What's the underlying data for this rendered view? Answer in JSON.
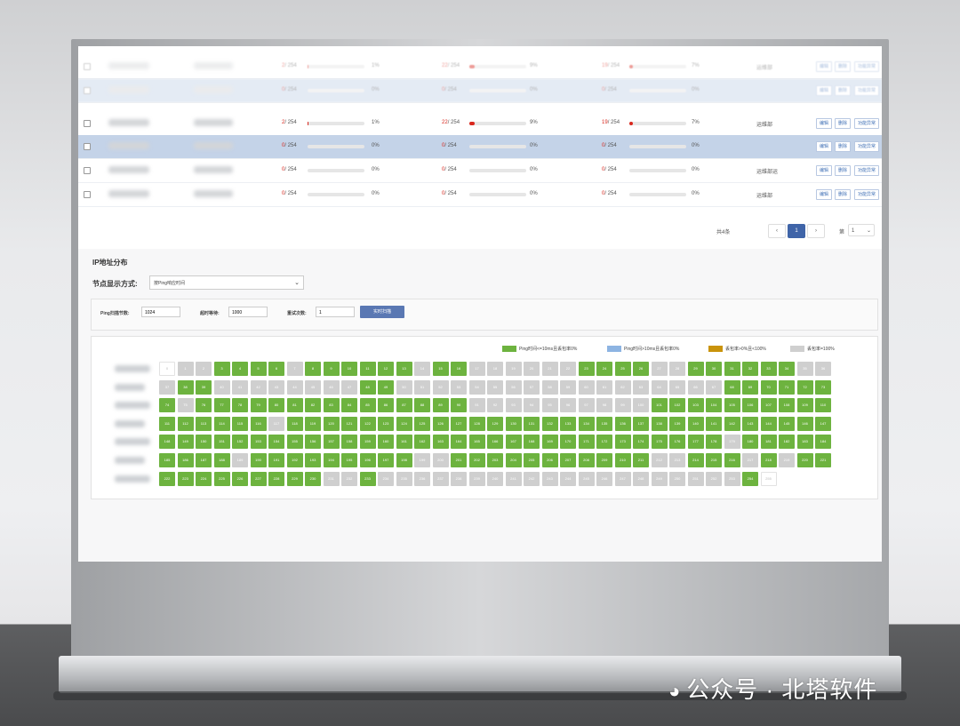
{
  "table": {
    "rows": [
      {
        "c1": "2/ 254",
        "p1": "1%",
        "f1": 0.01,
        "c2": "22/ 254",
        "p2": "9%",
        "f2": 0.09,
        "c3": "19/ 254",
        "p3": "7%",
        "f3": 0.07,
        "status": "运维部",
        "actions": [
          "编辑",
          "删除",
          "功能异常"
        ],
        "faded": true
      },
      {
        "c1": "0/ 254",
        "p1": "0%",
        "f1": 0,
        "c2": "0/ 254",
        "p2": "0%",
        "f2": 0,
        "c3": "0/ 254",
        "p3": "0%",
        "f3": 0,
        "status": "",
        "actions": [
          "编辑",
          "删除",
          "功能异常"
        ],
        "faded": true
      },
      {
        "c1": "2/ 254",
        "p1": "1%",
        "f1": 0.01,
        "c2": "22/ 254",
        "p2": "9%",
        "f2": 0.09,
        "c3": "19/ 254",
        "p3": "7%",
        "f3": 0.07,
        "status": "运维部",
        "actions": [
          "编辑",
          "删除",
          "功能异常"
        ],
        "faded": false
      },
      {
        "c1": "0/ 254",
        "p1": "0%",
        "f1": 0,
        "c2": "0/ 254",
        "p2": "0%",
        "f2": 0,
        "c3": "0/ 254",
        "p3": "0%",
        "f3": 0,
        "status": "",
        "actions": [
          "编辑",
          "删除",
          "功能异常"
        ],
        "faded": false
      },
      {
        "c1": "0/ 254",
        "p1": "0%",
        "f1": 0,
        "c2": "0/ 254",
        "p2": "0%",
        "f2": 0,
        "c3": "0/ 254",
        "p3": "0%",
        "f3": 0,
        "status": "运维部运",
        "actions": [
          "编辑",
          "删除",
          "功能异常"
        ],
        "faded": false
      },
      {
        "c1": "0/ 254",
        "p1": "0%",
        "f1": 0,
        "c2": "0/ 254",
        "p2": "0%",
        "f2": 0,
        "c3": "0/ 254",
        "p3": "0%",
        "f3": 0,
        "status": "运维部",
        "actions": [
          "编辑",
          "删除",
          "功能异常"
        ],
        "faded": false
      }
    ]
  },
  "pager": {
    "total": "共4条",
    "prev": "‹",
    "page": "1",
    "next": "›",
    "goto_label": "第",
    "goto_value": "1"
  },
  "ip": {
    "title": "IP地址分布",
    "mode_label": "节点显示方式:",
    "mode_value": "按Ping响应时间",
    "params": [
      {
        "label": "Ping扫描节数:",
        "value": "1024"
      },
      {
        "label": "超时等待:",
        "value": "1000"
      },
      {
        "label": "重试次数:",
        "value": "1"
      }
    ],
    "scan_button": "实时扫描",
    "legend": [
      {
        "label": "Ping时间<=10ms且丢包率0%",
        "color": "#6db33f"
      },
      {
        "label": "Ping时间>10ms且丢包率0%",
        "color": "#8db4e2"
      },
      {
        "label": "丢包率>0%且<100%",
        "color": "#c9930b"
      },
      {
        "label": "丢包率=100%",
        "color": "#cfcfcf"
      }
    ],
    "grey_cells": [
      1,
      2,
      7,
      14,
      17,
      18,
      19,
      20,
      21,
      22,
      27,
      28,
      35,
      36,
      37,
      40,
      41,
      42,
      43,
      44,
      45,
      46,
      47,
      50,
      51,
      52,
      53,
      54,
      55,
      56,
      57,
      58,
      59,
      60,
      61,
      62,
      63,
      64,
      65,
      66,
      67,
      75,
      91,
      92,
      93,
      94,
      95,
      96,
      97,
      98,
      99,
      100,
      117,
      179,
      189,
      199,
      200,
      212,
      213,
      217,
      219,
      231,
      232,
      234,
      235,
      236,
      237,
      238,
      239,
      240,
      241,
      242,
      243,
      244,
      245,
      246,
      247,
      248,
      249,
      250,
      251,
      252,
      253
    ],
    "green_only_cells": [
      3,
      4,
      5,
      6,
      8,
      9,
      10,
      11,
      12,
      13,
      15,
      16,
      23,
      24,
      25,
      26,
      29,
      30,
      31,
      32,
      33,
      34,
      38,
      39,
      48,
      49,
      68,
      69,
      70,
      71,
      72,
      73,
      74,
      76,
      77,
      78,
      79,
      80,
      81,
      82,
      83,
      84,
      85,
      86,
      87,
      88,
      89,
      90,
      101,
      102,
      103,
      104,
      105,
      106,
      107,
      108,
      109,
      110,
      111,
      112,
      113,
      114,
      115,
      116,
      118,
      119,
      120
    ],
    "first_cell_label": "0",
    "last_cell_label": "255"
  },
  "watermark": "公众号 · 北塔软件"
}
